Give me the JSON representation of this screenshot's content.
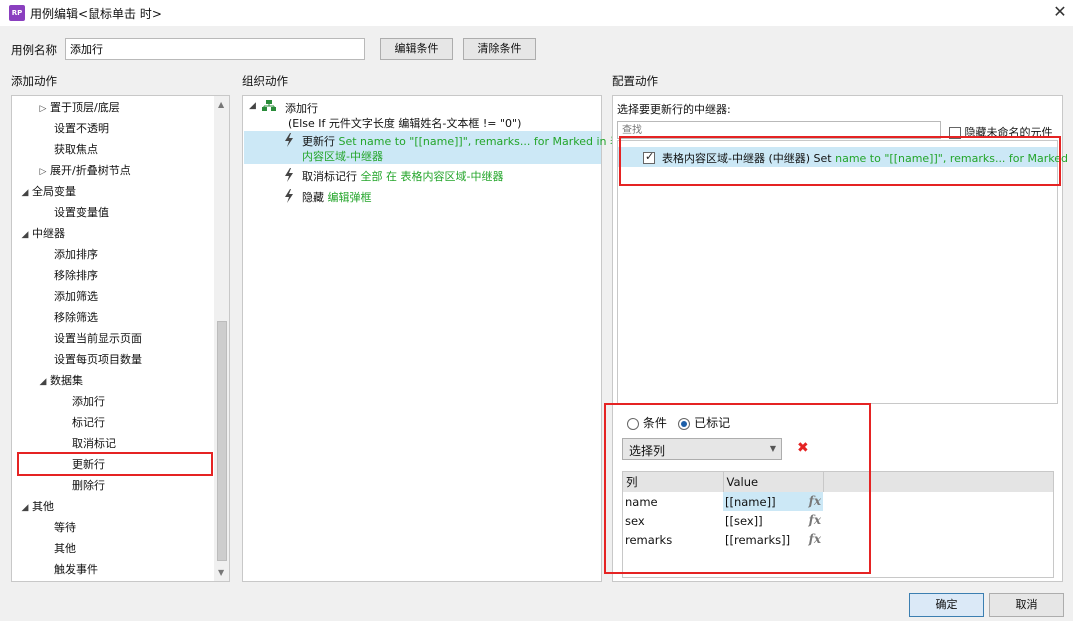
{
  "window": {
    "title": "用例编辑<鼠标单击 时>",
    "app_icon": "RP",
    "close": "✕"
  },
  "case_name": {
    "label": "用例名称",
    "value": "添加行",
    "edit_condition": "编辑条件",
    "clear_condition": "清除条件"
  },
  "add_action": {
    "header": "添加动作",
    "items": [
      {
        "label": "置于顶层/底层",
        "toggle": "▷"
      },
      {
        "label": "设置不透明"
      },
      {
        "label": "获取焦点"
      },
      {
        "label": "展开/折叠树节点",
        "toggle": "▷"
      },
      {
        "label": "全局变量",
        "toggle": "◢"
      },
      {
        "label": "设置变量值"
      },
      {
        "label": "中继器",
        "toggle": "◢"
      },
      {
        "label": "添加排序"
      },
      {
        "label": "移除排序"
      },
      {
        "label": "添加筛选"
      },
      {
        "label": "移除筛选"
      },
      {
        "label": "设置当前显示页面"
      },
      {
        "label": "设置每页项目数量"
      },
      {
        "label": "数据集",
        "toggle": "◢"
      },
      {
        "label": "添加行"
      },
      {
        "label": "标记行"
      },
      {
        "label": "取消标记"
      },
      {
        "label": "更新行"
      },
      {
        "label": "删除行"
      },
      {
        "label": "其他",
        "toggle": "◢"
      },
      {
        "label": "等待"
      },
      {
        "label": "其他"
      },
      {
        "label": "触发事件"
      }
    ]
  },
  "organize": {
    "header": "组织动作",
    "case_title": "添加行",
    "case_condition": "(Else If 元件文字长度 编辑姓名-文本框 != \"0\")",
    "actions": [
      {
        "name": "更新行",
        "detail_line1": "Set name to \"[[name]]\", remarks... for Marked in 表格",
        "detail_line2": "内容区域-中继器"
      },
      {
        "name": "取消标记行",
        "detail_line1": "全部 在 表格内容区域-中继器"
      },
      {
        "name": "隐藏",
        "detail_line1": "编辑弹框"
      }
    ]
  },
  "configure": {
    "header": "配置动作",
    "subtitle": "选择要更新行的中继器:",
    "search_placeholder": "查找",
    "hide_unnamed": "隐藏未命名的元件",
    "repeater_name": "表格内容区域-中继器 (中继器) Set",
    "repeater_detail": "name to \"[[name]]\", remarks... for Marked",
    "radio_condition": "条件",
    "radio_marked": "已标记",
    "select_column": "选择列",
    "table_headers": [
      "列",
      "Value"
    ],
    "rows": [
      {
        "col": "name",
        "value": "[[name]]",
        "fx": "fx"
      },
      {
        "col": "sex",
        "value": "[[sex]]",
        "fx": "fx"
      },
      {
        "col": "remarks",
        "value": "[[remarks]]",
        "fx": "fx"
      }
    ],
    "delete_glyph": "✖"
  },
  "footer": {
    "ok": "确定",
    "cancel": "取消"
  },
  "colors": {
    "accent_green": "#23a52a",
    "highlight_red": "#e52323",
    "selection_blue": "#cce8f6"
  }
}
